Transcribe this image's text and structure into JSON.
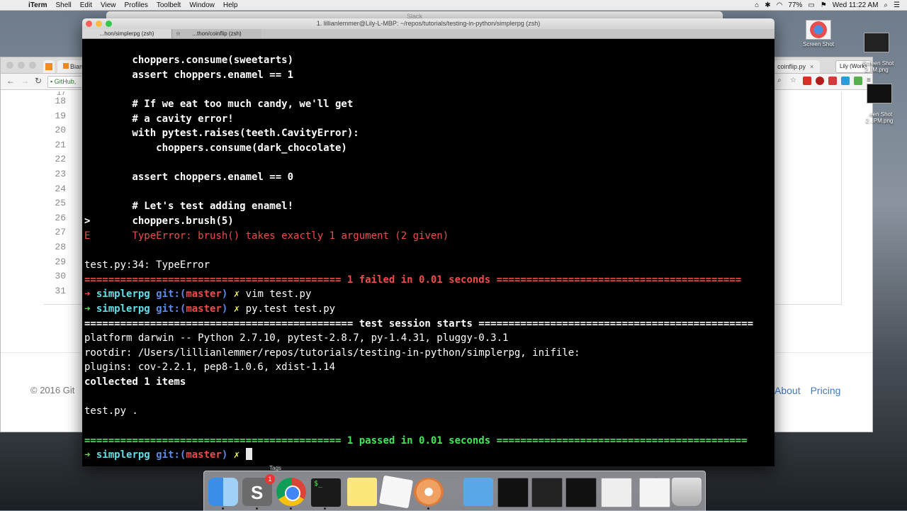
{
  "menubar": {
    "app_name": "iTerm",
    "items": [
      "Shell",
      "Edit",
      "View",
      "Profiles",
      "Toolbelt",
      "Window",
      "Help"
    ],
    "battery": "77%",
    "clock": "Wed 11:22 AM"
  },
  "slack_window": {
    "title": "Slack"
  },
  "browser": {
    "tab_left_label": "Bian",
    "tab_right_label": "coinflip.py",
    "tab_right_close": "×",
    "profile_button": "Lily (Work)",
    "url_text": "GitHub,",
    "line_numbers": [
      "17",
      "18",
      "19",
      "20",
      "21",
      "22",
      "23",
      "24",
      "25",
      "26",
      "27",
      "28",
      "29",
      "30",
      "31"
    ],
    "footer_left": "© 2016 Git",
    "footer_right": [
      "About",
      "Pricing"
    ]
  },
  "desktop": {
    "icons": [
      {
        "label": "Screen Shot"
      },
      {
        "label": "Screen Shot\n2...M.png"
      },
      {
        "label": "een Shot\n2...PM.png"
      }
    ]
  },
  "terminal": {
    "title": "1. lillianlemmer@Lily-L-MBP: ~/repos/tutorials/testing-in-python/simplerpg (zsh)",
    "tabs": [
      {
        "label": "...hon/simplerpg (zsh)"
      },
      {
        "label": "...thon/coinflip (zsh)"
      }
    ],
    "lines": {
      "l1": "        choppers.consume(sweetarts)",
      "l2": "        assert choppers.enamel == 1",
      "l3": "",
      "l4": "        # If we eat too much candy, we'll get",
      "l5": "        # a cavity error!",
      "l6": "        with pytest.raises(teeth.CavityError):",
      "l7": "            choppers.consume(dark_chocolate)",
      "l8": "",
      "l9": "        assert choppers.enamel == 0",
      "l10": "",
      "l11": "        # Let's test adding enamel!",
      "l12_marker": ">",
      "l12": "       choppers.brush(5)",
      "l13_marker": "E",
      "l13": "       TypeError: brush() takes exactly 1 argument (2 given)",
      "l14": "",
      "l15": "test.py:34: TypeError",
      "l16_left": "=========================================== ",
      "l16_mid": "1 failed in 0.01 seconds",
      "l16_right": " =========================================",
      "prompt_arrow": "➜",
      "prompt_dir": "simplerpg",
      "prompt_git": "git:(",
      "prompt_branch": "master",
      "prompt_git_close": ")",
      "prompt_dirty": "✗",
      "cmd1": "vim test.py",
      "cmd2": "py.test test.py",
      "l19": "============================================= test session starts ==============================================",
      "l20": "platform darwin -- Python 2.7.10, pytest-2.8.7, py-1.4.31, pluggy-0.3.1",
      "l21": "rootdir: /Users/lillianlemmer/repos/tutorials/testing-in-python/simplerpg, inifile:",
      "l22": "plugins: cov-2.2.1, pep8-1.0.6, xdist-1.14",
      "l23": "collected 1 items",
      "l24": "",
      "l25": "test.py .",
      "l26": "",
      "l27_left": "=========================================== ",
      "l27_mid": "1 passed in 0.01 seconds",
      "l27_right": " =========================================="
    }
  },
  "dock": {
    "hover_label": "Tags",
    "badge": "1"
  }
}
